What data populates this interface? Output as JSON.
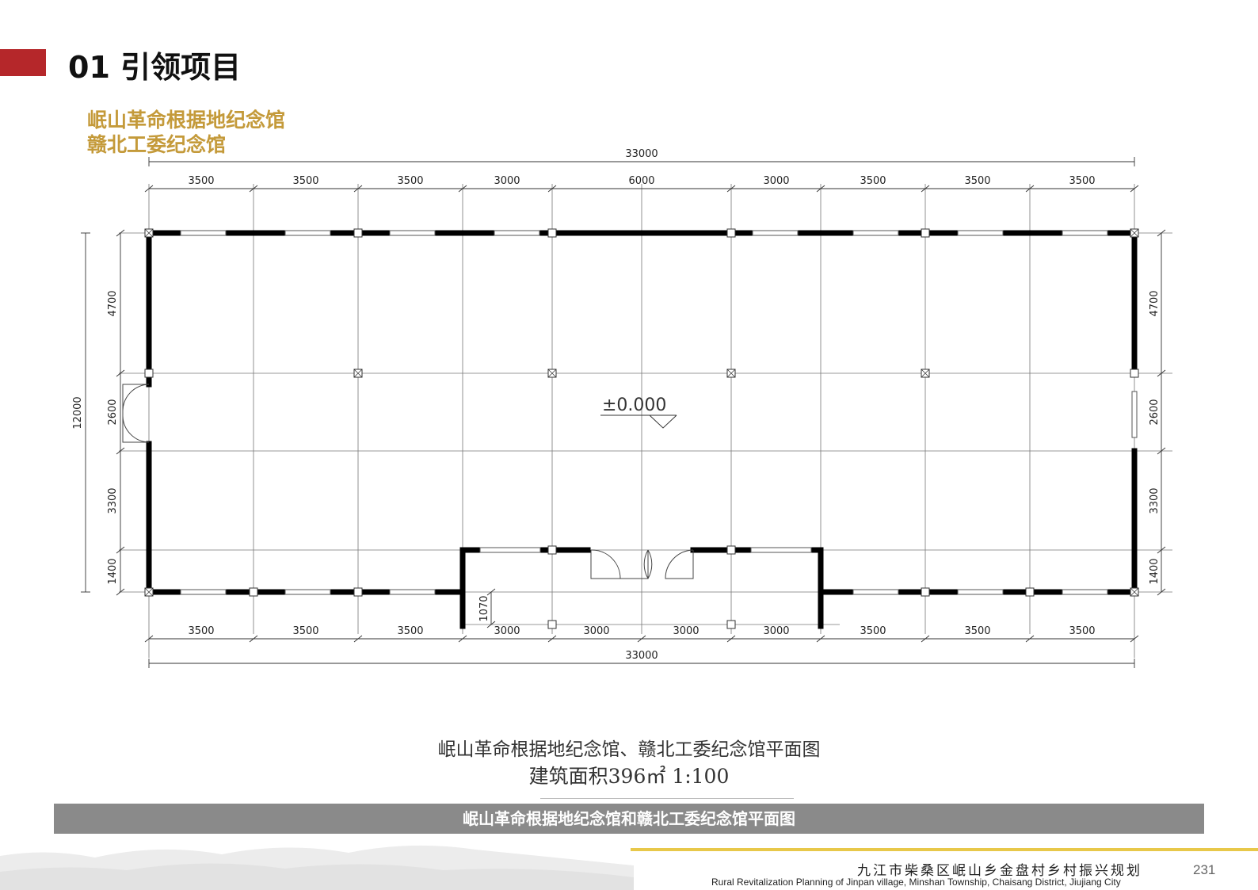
{
  "header": {
    "title": "01  引领项目",
    "subtitle_1": "岷山革命根据地纪念馆",
    "subtitle_2": "赣北工委纪念馆"
  },
  "plan": {
    "overall_width": "33000",
    "top_spans": [
      "3500",
      "3500",
      "3500",
      "3000",
      "6000",
      "3000",
      "3500",
      "3500",
      "3500"
    ],
    "bottom_spans": [
      "3500",
      "3500",
      "3500",
      "3000",
      "3000",
      "3000",
      "3000",
      "3500",
      "3500",
      "3500"
    ],
    "overall_depth": "12000",
    "side_spans": [
      "4700",
      "2600",
      "3300",
      "1400"
    ],
    "porch_depth": "1070",
    "elevation": "±0.000"
  },
  "caption": {
    "line_1": "岷山革命根据地纪念馆、赣北工委纪念馆平面图",
    "line_2": "建筑面积396㎡    1:100"
  },
  "banner": {
    "label": "岷山革命根据地纪念馆和赣北工委纪念馆平面图"
  },
  "footer": {
    "title_cn": "九江市柴桑区岷山乡金盘村乡村振兴规划",
    "title_en": "Rural Revitalization Planning of Jinpan village, Minshan Township, Chaisang District, Jiujiang City",
    "page_number": "231"
  }
}
